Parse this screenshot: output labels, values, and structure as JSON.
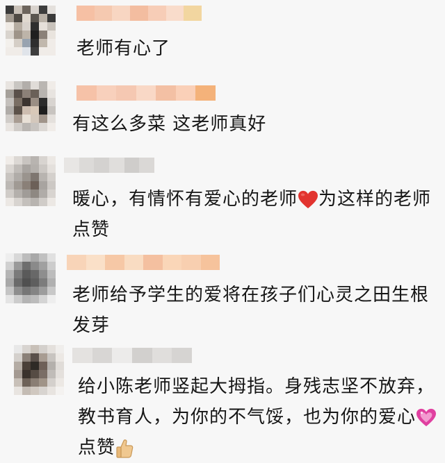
{
  "comments": [
    {
      "text": "老师有心了"
    },
    {
      "text": "有这么多菜 这老师真好"
    },
    {
      "text_before": "暖心，有情怀有爱心的老师",
      "emoji": "heart-emoji",
      "text_after": "为这样的老师",
      "line2": "点赞"
    },
    {
      "text": "老师给予学生的爱将在孩子们心灵之田生根",
      "line2": "发芽"
    },
    {
      "text": "给小陈老师竖起大拇指。身残志坚不放弃，",
      "line2_before": "教书育人，为你的不气馁，也为你的爱心",
      "emoji": "sparkling-heart-emoji",
      "line3": "点赞",
      "emoji2": "thumbs-up-emoji"
    }
  ],
  "colors": {
    "background": "#f7f7f7",
    "text": "#161616",
    "heart": "#e2342f",
    "pink_heart": "#e040a0",
    "thumb": "#f0c890"
  }
}
